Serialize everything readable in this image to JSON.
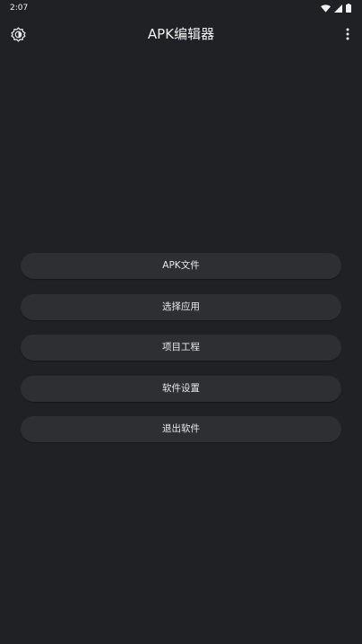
{
  "status_bar": {
    "time": "2:07"
  },
  "app_bar": {
    "title": "APK编辑器",
    "left_icon": "settings-brightness-icon",
    "right_icon": "more-vert-icon"
  },
  "menu": {
    "items": [
      {
        "label": "APK文件"
      },
      {
        "label": "选择应用"
      },
      {
        "label": "项目工程"
      },
      {
        "label": "软件设置"
      },
      {
        "label": "退出软件"
      }
    ]
  },
  "colors": {
    "background": "#202124",
    "button": "#2E2F33",
    "text": "#E8E8E8"
  }
}
